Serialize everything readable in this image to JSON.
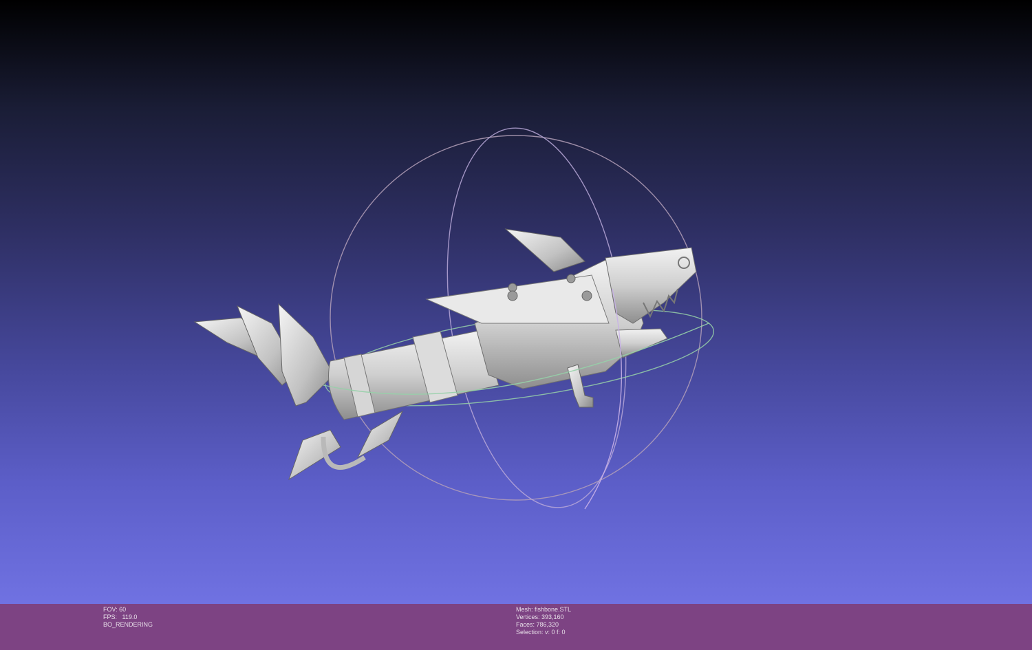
{
  "viewport": {
    "model_label": "fishbone.STL",
    "trackball": {
      "ring_colors": [
        "#d08a98",
        "#a8a8c8",
        "#8ac8a0",
        "#c8b0e8"
      ]
    },
    "background": {
      "top": "#000000",
      "bottom": "#7072e2"
    }
  },
  "status_bar": {
    "background": "#7d4383",
    "render_info": {
      "fov": "FOV: 60",
      "fps": "FPS:   119.0",
      "mode": "BO_RENDERING"
    },
    "mesh_info": {
      "mesh": "Mesh: fishbone.STL",
      "vertices": "Vertices: 393,160",
      "faces": "Faces: 786,320",
      "selection": "Selection: v: 0 f: 0"
    }
  }
}
